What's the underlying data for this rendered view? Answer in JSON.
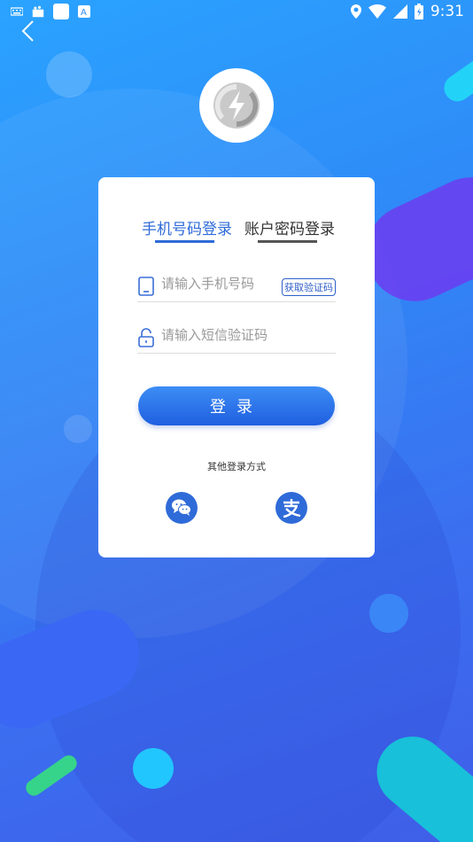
{
  "status_bar": {
    "time": "9:31",
    "icons": [
      "keyboard-icon",
      "notification-icon",
      "square-icon",
      "a-icon",
      "location-icon",
      "wifi-icon",
      "signal-icon",
      "battery-icon"
    ]
  },
  "tabs": {
    "phone_login": "手机号码登录",
    "password_login": "账户密码登录"
  },
  "form": {
    "phone_placeholder": "请输入手机号码",
    "phone_value": "",
    "code_placeholder": "请输入短信验证码",
    "code_value": "",
    "get_code": "获取验证码",
    "login_button": "登录"
  },
  "other_login": {
    "label": "其他登录方式",
    "options": [
      "wechat-icon",
      "alipay-icon"
    ]
  },
  "colors": {
    "accent": "#2f6bd8",
    "bg_top": "#2aa3ff",
    "bg_bottom": "#3f5ee8"
  }
}
